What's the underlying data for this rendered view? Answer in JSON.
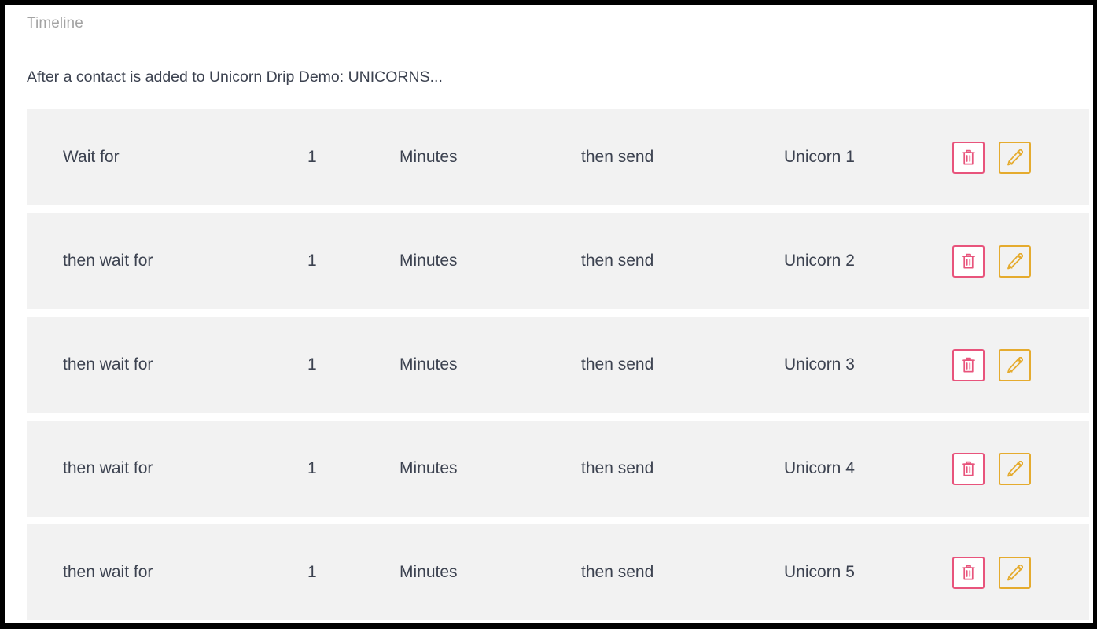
{
  "panel": {
    "section_label": "Timeline",
    "trigger_text": "After a contact is added to Unicorn Drip Demo: UNICORNS...",
    "accent_colors": {
      "delete": "#e8547c",
      "edit": "#e5ab2e",
      "row_background": "#f2f2f2",
      "text": "#3c4250",
      "muted_text": "#a3a3a3"
    }
  },
  "actions": {
    "delete_label": "Delete step",
    "edit_label": "Edit step",
    "delete_icon": "trash-icon",
    "edit_icon": "pencil-icon"
  },
  "steps": [
    {
      "wait_label": "Wait for",
      "amount": "1",
      "unit": "Minutes",
      "send_label": "then send",
      "target": "Unicorn 1"
    },
    {
      "wait_label": "then wait for",
      "amount": "1",
      "unit": "Minutes",
      "send_label": "then send",
      "target": "Unicorn 2"
    },
    {
      "wait_label": "then wait for",
      "amount": "1",
      "unit": "Minutes",
      "send_label": "then send",
      "target": "Unicorn 3"
    },
    {
      "wait_label": "then wait for",
      "amount": "1",
      "unit": "Minutes",
      "send_label": "then send",
      "target": "Unicorn 4"
    },
    {
      "wait_label": "then wait for",
      "amount": "1",
      "unit": "Minutes",
      "send_label": "then send",
      "target": "Unicorn 5"
    }
  ]
}
